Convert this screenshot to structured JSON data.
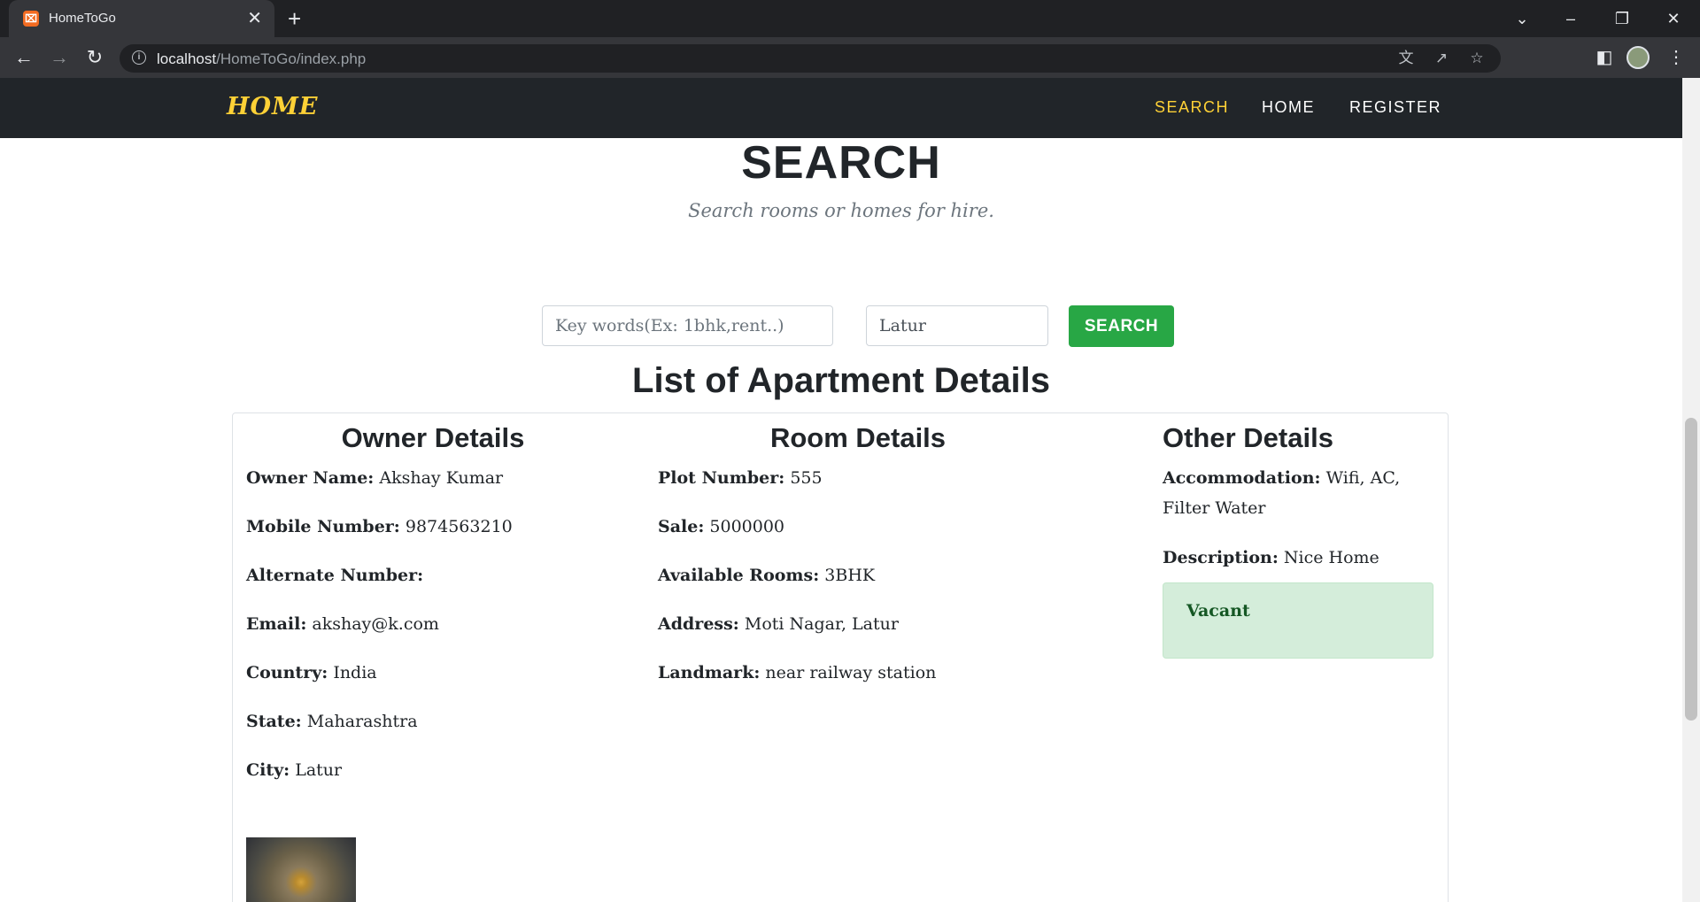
{
  "browser": {
    "tab_title": "HomeToGo",
    "favicon": "xampp-favicon-icon",
    "url_host": "localhost",
    "url_path": "/HomeToGo/index.php"
  },
  "nav": {
    "brand": "HOME",
    "links": [
      "SEARCH",
      "HOME",
      "REGISTER"
    ],
    "active_link": "SEARCH",
    "accent_color": "#fed136",
    "background_color": "#212529"
  },
  "header": {
    "title": "SEARCH",
    "subtitle": "Search rooms or homes for hire."
  },
  "search": {
    "keywords_placeholder": "Key words(Ex: 1bhk,rent..)",
    "keywords_value": "",
    "location_value": "Latur",
    "button_label": "SEARCH",
    "button_color": "#28a745"
  },
  "listing": {
    "heading": "List of Apartment Details",
    "owner": {
      "title": "Owner Details",
      "name_label": "Owner Name:",
      "name": "Akshay Kumar",
      "mobile_label": "Mobile Number:",
      "mobile": "9874563210",
      "alternate_label": "Alternate Number:",
      "alternate": "",
      "email_label": "Email:",
      "email": "akshay@k.com",
      "country_label": "Country:",
      "country": "India",
      "state_label": "State:",
      "state": "Maharashtra",
      "city_label": "City:",
      "city": "Latur"
    },
    "room": {
      "title": "Room Details",
      "plot_label": "Plot Number:",
      "plot": "555",
      "sale_label": "Sale:",
      "sale": "5000000",
      "rooms_label": "Available Rooms:",
      "rooms": "3BHK",
      "address_label": "Address:",
      "address": "Moti Nagar, Latur",
      "landmark_label": "Landmark:",
      "landmark": "near railway station"
    },
    "other": {
      "title": "Other Details",
      "accommodation_label": "Accommodation:",
      "accommodation": "Wifi, AC, Filter Water",
      "description_label": "Description:",
      "description": "Nice Home",
      "status": "Vacant",
      "status_color": "#155724"
    }
  }
}
